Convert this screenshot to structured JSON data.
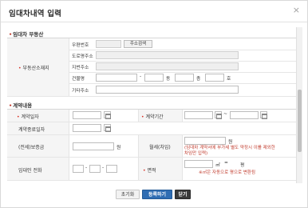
{
  "dialog": {
    "title": "임대차내역 입력",
    "close": "×"
  },
  "section1": {
    "title": "임대차 부동산",
    "field_label": "부동산소재지",
    "rows": {
      "zip": "우편번호",
      "road": "도로명주소",
      "jibun": "지번주소",
      "building": "건물명",
      "other": "기타주소"
    },
    "zip_button": "주소검색",
    "dong_suffix": "동",
    "floor_suffix": "층",
    "ho_suffix": "호",
    "separator": "-"
  },
  "section2": {
    "title": "계약내용",
    "contract_date": "계약일자",
    "contract_period": "계약기간",
    "period_sep": "~",
    "end_date": "계약종료일자",
    "deposit": "(전세)보증금",
    "deposit_unit": "원",
    "rent": "월세(차임)",
    "rent_unit": "원",
    "rent_note": "(임대차 계약서에 부가세 별도 약정시 이를 제외한 차임만 입력)",
    "phone": "임대인 전화",
    "phone_sep": "-",
    "area": "면적",
    "area_unit1": "㎡",
    "area_eq": "=",
    "area_unit2": "평",
    "area_note": "※㎡은 자동으로 평으로 변환됨"
  },
  "footer": {
    "reset": "초기화",
    "save": "등록하기",
    "close": "닫기"
  }
}
